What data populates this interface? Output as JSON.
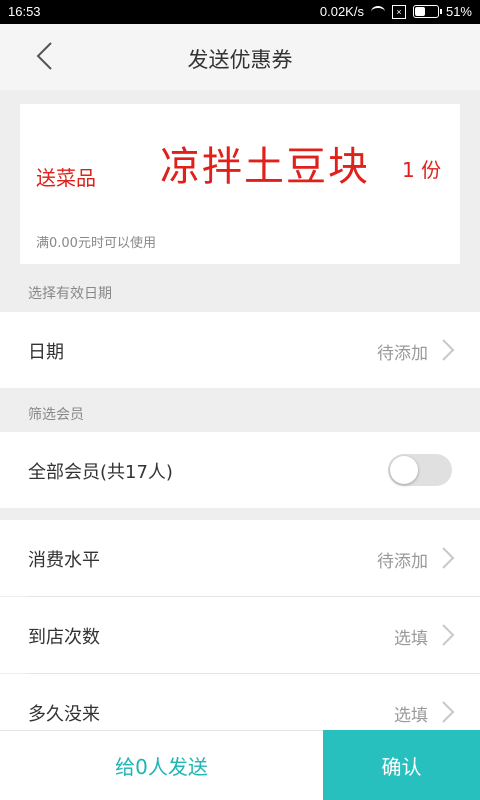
{
  "status_bar": {
    "time": "16:53",
    "network_speed": "0.02K/s",
    "battery_percent": "51%",
    "battery_level": 0.51,
    "icons": [
      "wifi-icon",
      "sim-disabled-icon",
      "battery-icon"
    ]
  },
  "nav": {
    "title": "发送优惠券",
    "back_icon": "chevron-left-icon"
  },
  "coupon": {
    "prefix": "送菜品",
    "dish_name": "凉拌土豆块",
    "quantity": "1 份",
    "condition": "满0.00元时可以使用"
  },
  "validity": {
    "section_label": "选择有效日期",
    "date_label": "日期",
    "date_value": "待添加"
  },
  "members": {
    "section_label": "筛选会员",
    "all_members_label": "全部会员(共17人)",
    "all_members_toggle_on": false
  },
  "filters": [
    {
      "label": "消费水平",
      "value": "待添加"
    },
    {
      "label": "到店次数",
      "value": "选填"
    },
    {
      "label": "多久没来",
      "value": "选填"
    }
  ],
  "bottom": {
    "send_label": "给0人发送",
    "confirm_label": "确认"
  },
  "colors": {
    "accent": "#27c0bf",
    "accent_text": "#1fb5b5",
    "coupon_red": "#e0201a",
    "background": "#eeeeee"
  }
}
